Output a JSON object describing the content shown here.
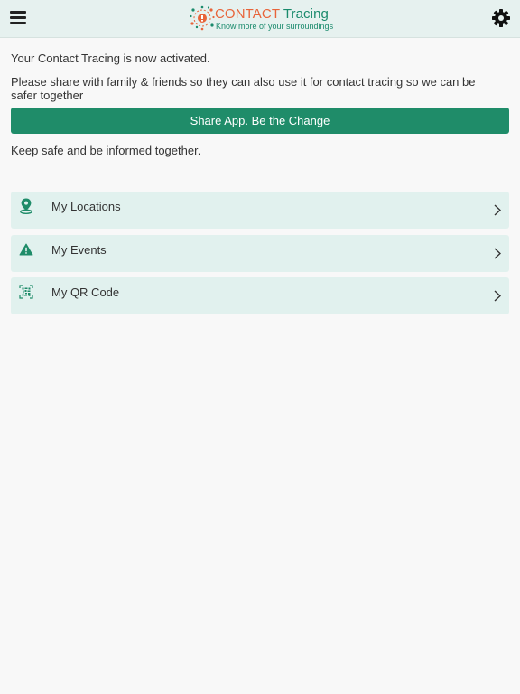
{
  "header": {
    "logo_title_main": "CONTACT",
    "logo_title_accent": "Tracing",
    "logo_tagline": "Know more of your surroundings",
    "menu_icon": "hamburger-icon",
    "settings_icon": "gear-icon"
  },
  "messages": {
    "activated": "Your Contact Tracing is now activated.",
    "share_prompt": "Please share with family & friends so they can also use it for contact tracing so we can be safer together",
    "keep_safe": "Keep safe and be informed together."
  },
  "share_button": {
    "label": "Share App. Be the Change"
  },
  "menu": {
    "items": [
      {
        "label": "My Locations",
        "icon": "location-pin-icon"
      },
      {
        "label": "My Events",
        "icon": "warning-icon"
      },
      {
        "label": "My QR Code",
        "icon": "qr-code-icon"
      }
    ]
  },
  "colors": {
    "header_bg": "#e6f1ef",
    "accent_green": "#1f8c69",
    "logo_orange": "#e8643a",
    "menu_item_bg": "#e1f1ee",
    "page_bg": "#f8f8f8"
  }
}
